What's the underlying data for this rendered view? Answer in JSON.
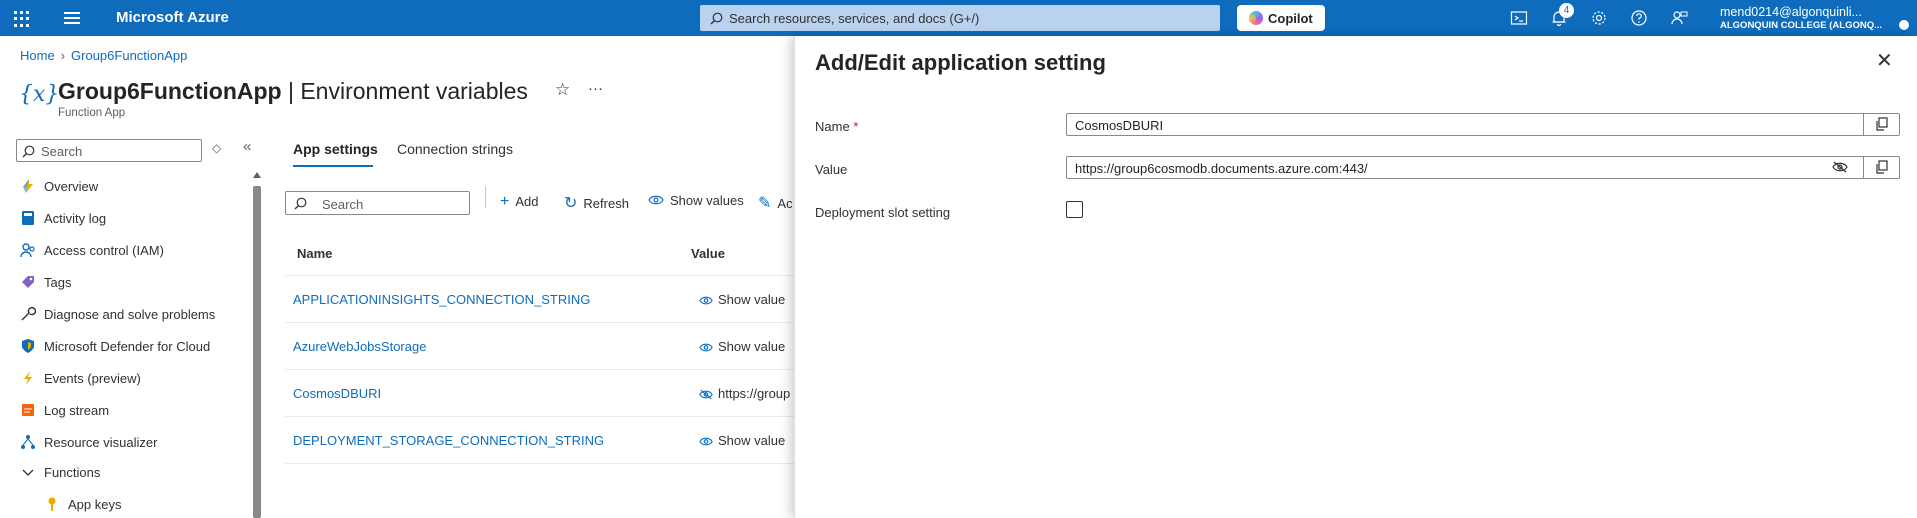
{
  "topbar": {
    "brand": "Microsoft Azure",
    "search_placeholder": "Search resources, services, and docs (G+/)",
    "copilot_label": "Copilot",
    "notification_count": "4",
    "account_user": "mend0214@algonquinli...",
    "account_org": "ALGONQUIN COLLEGE (ALGONQ..."
  },
  "breadcrumb": {
    "home": "Home",
    "resource": "Group6FunctionApp"
  },
  "header": {
    "resource_name": "Group6FunctionApp",
    "separator": " | ",
    "page_name": "Environment variables",
    "resource_type": "Function App"
  },
  "sidebar": {
    "search_placeholder": "Search",
    "items": [
      {
        "label": "Overview",
        "icon": "lightning-icon"
      },
      {
        "label": "Activity log",
        "icon": "log-book-icon"
      },
      {
        "label": "Access control (IAM)",
        "icon": "people-icon"
      },
      {
        "label": "Tags",
        "icon": "tag-icon"
      },
      {
        "label": "Diagnose and solve problems",
        "icon": "wrench-icon"
      },
      {
        "label": "Microsoft Defender for Cloud",
        "icon": "shield-icon"
      },
      {
        "label": "Events (preview)",
        "icon": "bolt-icon"
      },
      {
        "label": "Log stream",
        "icon": "log-stream-icon"
      },
      {
        "label": "Resource visualizer",
        "icon": "network-icon"
      },
      {
        "label": "Functions",
        "icon": "chevron-down-icon"
      },
      {
        "label": "App keys",
        "icon": "key-icon"
      }
    ]
  },
  "tabs": [
    {
      "label": "App settings",
      "active": true
    },
    {
      "label": "Connection strings",
      "active": false
    }
  ],
  "commands": {
    "search_placeholder": "Search",
    "add": "Add",
    "refresh": "Refresh",
    "show_values": "Show values",
    "edit": "Ac"
  },
  "table": {
    "columns": [
      "Name",
      "Value"
    ],
    "rows": [
      {
        "name": "APPLICATIONINSIGHTS_CONNECTION_STRING",
        "value": "Show value"
      },
      {
        "name": "AzureWebJobsStorage",
        "value": "Show value"
      },
      {
        "name": "CosmosDBURI",
        "value": "https://group"
      },
      {
        "name": "DEPLOYMENT_STORAGE_CONNECTION_STRING",
        "value": "Show value"
      }
    ]
  },
  "panel": {
    "title": "Add/Edit application setting",
    "name_label": "Name",
    "required_mark": "*",
    "name_value": "CosmosDBURI",
    "value_label": "Value",
    "value_value": "https://group6cosmodb.documents.azure.com:443/",
    "slot_label": "Deployment slot setting",
    "slot_checked": false
  },
  "colors": {
    "accent": "#0f6cbd",
    "topbar": "#0f6cbd",
    "required": "#a4262c"
  }
}
